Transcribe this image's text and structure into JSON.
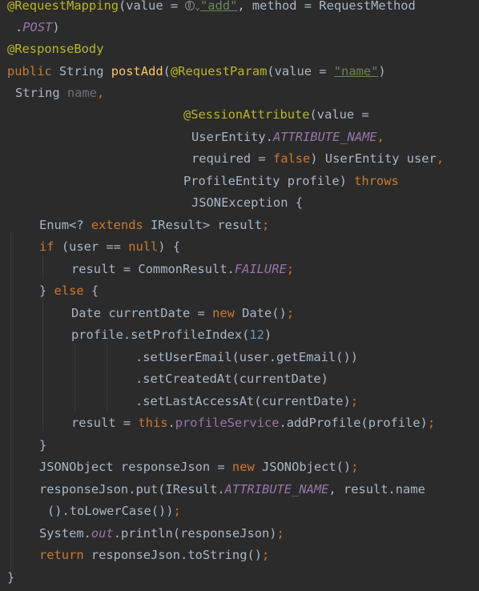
{
  "code": {
    "l1": {
      "ann": "@RequestMapping",
      "open": "(value = ",
      "str": "\"add\"",
      "mid": ", method = RequestMethod"
    },
    "l2": {
      "dot": ".",
      "const": "POST",
      "close": ")"
    },
    "l3": {
      "ann": "@ResponseBody"
    },
    "l4": {
      "kw": "public",
      "type": " String ",
      "fn": "postAdd",
      "open": "(",
      "ann": "@RequestParam",
      "val": "(value = ",
      "str": "\"name\"",
      "close": ")"
    },
    "l5": {
      "type": "String ",
      "param": "name",
      "comma": ","
    },
    "l6": {
      "ann": "@SessionAttribute",
      "val": "(value ="
    },
    "l7": {
      "cls": "UserEntity.",
      "const": "ATTRIBUTE_NAME",
      "comma": ","
    },
    "l8": {
      "req": "required = ",
      "kw": "false",
      "rest": ") UserEntity user",
      "comma": ","
    },
    "l9": {
      "text": "ProfileEntity profile) ",
      "kw": "throws"
    },
    "l10": {
      "text": "JSONException {"
    },
    "l11": {
      "a": "Enum<? ",
      "kw": "extends",
      "b": " IResult> result",
      "semi": ";"
    },
    "l12": {
      "kw": "if",
      "a": " (user == ",
      "kw2": "null",
      "b": ") {"
    },
    "l13": {
      "a": "result = CommonResult.",
      "const": "FAILURE",
      "semi": ";"
    },
    "l14": {
      "a": "} ",
      "kw": "else",
      "b": " {"
    },
    "l15": {
      "a": "Date currentDate = ",
      "kw": "new",
      "b": " Date()",
      "semi": ";"
    },
    "l16": {
      "a": "profile.setProfileIndex(",
      "num": "12",
      "b": ")"
    },
    "l17": {
      "a": ".setUserEmail(user.getEmail())"
    },
    "l18": {
      "a": ".setCreatedAt(currentDate)"
    },
    "l19": {
      "a": ".setLastAccessAt(currentDate)",
      "semi": ";"
    },
    "l20": {
      "a": "result = ",
      "kw": "this",
      "dot": ".",
      "field": "profileService",
      "b": ".addProfile(profile)",
      "semi": ";"
    },
    "l21": {
      "a": "}"
    },
    "l22": {
      "a": "JSONObject responseJson = ",
      "kw": "new",
      "b": " JSONObject()",
      "semi": ";"
    },
    "l23": {
      "a": "responseJson.put(IResult.",
      "const": "ATTRIBUTE_NAME",
      "b": ", result.name"
    },
    "l24": {
      "a": "().toLowerCase())",
      "semi": ";"
    },
    "l25": {
      "a": "System.",
      "const": "out",
      "b": ".println(responseJson)",
      "semi": ";"
    },
    "l26": {
      "kw": "return",
      "a": " responseJson.toString()",
      "semi": ";"
    },
    "l27": {
      "a": "}"
    }
  }
}
